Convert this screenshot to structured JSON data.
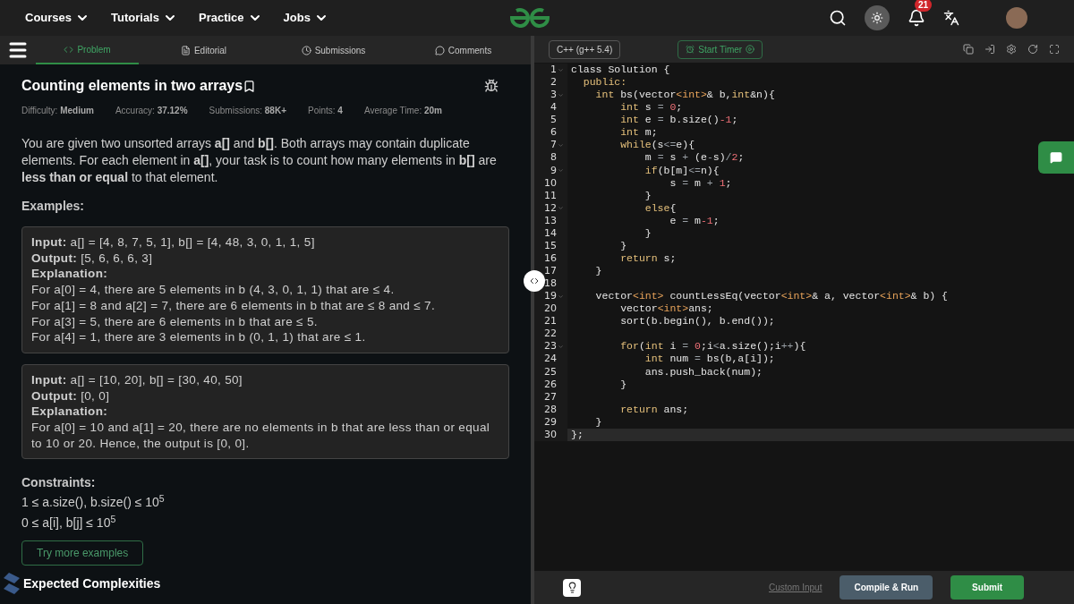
{
  "nav": {
    "links": [
      "Courses",
      "Tutorials",
      "Practice",
      "Jobs"
    ],
    "notifications": "21"
  },
  "tabs": [
    {
      "label": "Problem",
      "selected": true,
      "kind": "code"
    },
    {
      "label": "Editorial",
      "selected": false,
      "kind": "doc"
    },
    {
      "label": "Submissions",
      "selected": false,
      "kind": "clock"
    },
    {
      "label": "Comments",
      "selected": false,
      "kind": "chat"
    }
  ],
  "problem": {
    "title": "Counting elements in two arrays",
    "meta": [
      {
        "label": "Difficulty:",
        "value": "Medium"
      },
      {
        "label": "Accuracy:",
        "value": "37.12%"
      },
      {
        "label": "Submissions:",
        "value": "88K+"
      },
      {
        "label": "Points:",
        "value": "4"
      },
      {
        "label": "Average Time:",
        "value": "20m"
      }
    ],
    "description": "You are given two unsorted arrays **a[]** and **b[]**. Both arrays may contain duplicate elements. For each element in **a[]**, your task is to count how many elements in **b[]** are **less than or equal** to that element.",
    "examples_heading": "Examples:",
    "examples": [
      {
        "lines": [
          "**Input:** a[] = [4, 8, 7, 5, 1], b[] = [4, 48, 3, 0, 1, 1, 5]",
          "**Output:** [5, 6, 6, 6, 3]",
          "**Explanation:**",
          "For a[0] = 4, there are 5 elements in b (4, 3, 0, 1, 1) that are ≤ 4.",
          "For a[1] = 8 and a[2] = 7, there are 6 elements in b that are ≤ 8 and ≤ 7.",
          "For a[3] = 5, there are 6 elements in b that are ≤ 5.",
          "For a[4] = 1, there are 3 elements in b (0, 1, 1) that are ≤ 1."
        ]
      },
      {
        "lines": [
          "**Input:** a[] = [10, 20], b[] = [30, 40, 50]",
          "**Output:** [0, 0]",
          "**Explanation:**",
          "For a[0] = 10 and a[1] = 20, there are no elements in b that are less than or equal to 10 or 20. Hence, the output is [0, 0]."
        ]
      }
    ],
    "constraints_heading": "Constraints:",
    "constraints": [
      "1 ≤ a.size(), b.size() ≤ 10$^{5}$",
      "0 ≤ a[i], b[j] ≤ 10$^{5}$"
    ],
    "more_button": "Try more examples",
    "next_heading": "Expected Complexities"
  },
  "editor": {
    "language": "C++ (g++ 5.4)",
    "timer": "Start Timer",
    "lines": [
      {
        "number": "1",
        "foldable": true,
        "active": false,
        "segments": [
          {
            "text": "class Solution {",
            "kind": "plain"
          }
        ]
      },
      {
        "number": "2",
        "foldable": false,
        "active": false,
        "segments": [
          {
            "text": "  public:",
            "kind": "kw"
          }
        ]
      },
      {
        "number": "3",
        "foldable": true,
        "active": false,
        "segments": [
          {
            "text": "    int",
            "kind": "kw"
          },
          {
            "text": " bs(vector",
            "kind": "plain"
          },
          {
            "text": "<int>",
            "kind": "tp"
          },
          {
            "text": "& b,",
            "kind": "plain"
          },
          {
            "text": "int",
            "kind": "kw"
          },
          {
            "text": "&n){",
            "kind": "plain"
          }
        ]
      },
      {
        "number": "4",
        "foldable": false,
        "active": false,
        "segments": [
          {
            "text": "        int",
            "kind": "kw"
          },
          {
            "text": " s ",
            "kind": "plain"
          },
          {
            "text": "= ",
            "kind": "op"
          },
          {
            "text": "0",
            "kind": "num"
          },
          {
            "text": ";",
            "kind": "plain"
          }
        ]
      },
      {
        "number": "5",
        "foldable": false,
        "active": false,
        "segments": [
          {
            "text": "        int",
            "kind": "kw"
          },
          {
            "text": " e ",
            "kind": "plain"
          },
          {
            "text": "=",
            "kind": "op"
          },
          {
            "text": " b.size()",
            "kind": "plain"
          },
          {
            "text": "-1",
            "kind": "num"
          },
          {
            "text": ";",
            "kind": "plain"
          }
        ]
      },
      {
        "number": "6",
        "foldable": false,
        "active": false,
        "segments": [
          {
            "text": "        int",
            "kind": "kw"
          },
          {
            "text": " m;",
            "kind": "plain"
          }
        ]
      },
      {
        "number": "7",
        "foldable": true,
        "active": false,
        "segments": [
          {
            "text": "        while",
            "kind": "kw"
          },
          {
            "text": "(s",
            "kind": "plain"
          },
          {
            "text": "<=",
            "kind": "op"
          },
          {
            "text": "e){",
            "kind": "plain"
          }
        ]
      },
      {
        "number": "8",
        "foldable": false,
        "active": false,
        "segments": [
          {
            "text": "            m ",
            "kind": "plain"
          },
          {
            "text": "=",
            "kind": "op"
          },
          {
            "text": " s ",
            "kind": "plain"
          },
          {
            "text": "+",
            "kind": "op"
          },
          {
            "text": " (e",
            "kind": "plain"
          },
          {
            "text": "-",
            "kind": "op"
          },
          {
            "text": "s)",
            "kind": "plain"
          },
          {
            "text": "/",
            "kind": "op"
          },
          {
            "text": "2",
            "kind": "num"
          },
          {
            "text": ";",
            "kind": "plain"
          }
        ]
      },
      {
        "number": "9",
        "foldable": true,
        "active": false,
        "segments": [
          {
            "text": "            if",
            "kind": "kw"
          },
          {
            "text": "(b[m]",
            "kind": "plain"
          },
          {
            "text": "<=",
            "kind": "op"
          },
          {
            "text": "n){",
            "kind": "plain"
          }
        ]
      },
      {
        "number": "10",
        "foldable": false,
        "active": false,
        "segments": [
          {
            "text": "                s ",
            "kind": "plain"
          },
          {
            "text": "=",
            "kind": "op"
          },
          {
            "text": " m ",
            "kind": "plain"
          },
          {
            "text": "+ ",
            "kind": "op"
          },
          {
            "text": "1",
            "kind": "num"
          },
          {
            "text": ";",
            "kind": "plain"
          }
        ]
      },
      {
        "number": "11",
        "foldable": false,
        "active": false,
        "segments": [
          {
            "text": "            }",
            "kind": "plain"
          }
        ]
      },
      {
        "number": "12",
        "foldable": true,
        "active": false,
        "segments": [
          {
            "text": "            else",
            "kind": "kw"
          },
          {
            "text": "{",
            "kind": "plain"
          }
        ]
      },
      {
        "number": "13",
        "foldable": false,
        "active": false,
        "segments": [
          {
            "text": "                e ",
            "kind": "plain"
          },
          {
            "text": "=",
            "kind": "op"
          },
          {
            "text": " m",
            "kind": "plain"
          },
          {
            "text": "-1",
            "kind": "num"
          },
          {
            "text": ";",
            "kind": "plain"
          }
        ]
      },
      {
        "number": "14",
        "foldable": false,
        "active": false,
        "segments": [
          {
            "text": "            }",
            "kind": "plain"
          }
        ]
      },
      {
        "number": "15",
        "foldable": false,
        "active": false,
        "segments": [
          {
            "text": "        }",
            "kind": "plain"
          }
        ]
      },
      {
        "number": "16",
        "foldable": false,
        "active": false,
        "segments": [
          {
            "text": "        return",
            "kind": "kw"
          },
          {
            "text": " s;",
            "kind": "plain"
          }
        ]
      },
      {
        "number": "17",
        "foldable": false,
        "active": false,
        "segments": [
          {
            "text": "    }",
            "kind": "plain"
          }
        ]
      },
      {
        "number": "18",
        "foldable": false,
        "active": false
      },
      {
        "number": "19",
        "foldable": true,
        "active": false,
        "segments": [
          {
            "text": "    vector",
            "kind": "plain"
          },
          {
            "text": "<int>",
            "kind": "tp"
          },
          {
            "text": " countLessEq(vector",
            "kind": "plain"
          },
          {
            "text": "<int>",
            "kind": "tp"
          },
          {
            "text": "& a, vector",
            "kind": "plain"
          },
          {
            "text": "<int>",
            "kind": "tp"
          },
          {
            "text": "& b) {",
            "kind": "plain"
          }
        ]
      },
      {
        "number": "20",
        "foldable": false,
        "active": false,
        "segments": [
          {
            "text": "        vector",
            "kind": "plain"
          },
          {
            "text": "<int>",
            "kind": "tp"
          },
          {
            "text": "ans;",
            "kind": "plain"
          }
        ]
      },
      {
        "number": "21",
        "foldable": false,
        "active": false,
        "segments": [
          {
            "text": "        sort(b.begin(), b.end());",
            "kind": "plain"
          }
        ]
      },
      {
        "number": "22",
        "foldable": false,
        "active": false
      },
      {
        "number": "23",
        "foldable": true,
        "active": false,
        "segments": [
          {
            "text": "        for",
            "kind": "kw"
          },
          {
            "text": "(",
            "kind": "plain"
          },
          {
            "text": "int",
            "kind": "kw"
          },
          {
            "text": " i ",
            "kind": "plain"
          },
          {
            "text": "= ",
            "kind": "op"
          },
          {
            "text": "0",
            "kind": "num"
          },
          {
            "text": ";i",
            "kind": "plain"
          },
          {
            "text": "<",
            "kind": "op"
          },
          {
            "text": "a.size();i",
            "kind": "plain"
          },
          {
            "text": "++",
            "kind": "op"
          },
          {
            "text": "){",
            "kind": "plain"
          }
        ]
      },
      {
        "number": "24",
        "foldable": false,
        "active": false,
        "segments": [
          {
            "text": "            int",
            "kind": "kw"
          },
          {
            "text": " num ",
            "kind": "plain"
          },
          {
            "text": "=",
            "kind": "op"
          },
          {
            "text": " bs(b,a[i]);",
            "kind": "plain"
          }
        ]
      },
      {
        "number": "25",
        "foldable": false,
        "active": false,
        "segments": [
          {
            "text": "            ans.push_back(num);",
            "kind": "plain"
          }
        ]
      },
      {
        "number": "26",
        "foldable": false,
        "active": false,
        "segments": [
          {
            "text": "        }",
            "kind": "plain"
          }
        ]
      },
      {
        "number": "27",
        "foldable": false,
        "active": false
      },
      {
        "number": "28",
        "foldable": false,
        "active": false,
        "segments": [
          {
            "text": "        return",
            "kind": "kw"
          },
          {
            "text": " ans;",
            "kind": "plain"
          }
        ]
      },
      {
        "number": "29",
        "foldable": false,
        "active": false,
        "segments": [
          {
            "text": "    }",
            "kind": "plain"
          }
        ]
      },
      {
        "number": "30",
        "foldable": false,
        "active": true,
        "segments": [
          {
            "text": "};",
            "kind": "plain"
          }
        ]
      }
    ],
    "custom_input": "Custom Input",
    "compile": "Compile & Run",
    "submit": "Submit"
  }
}
